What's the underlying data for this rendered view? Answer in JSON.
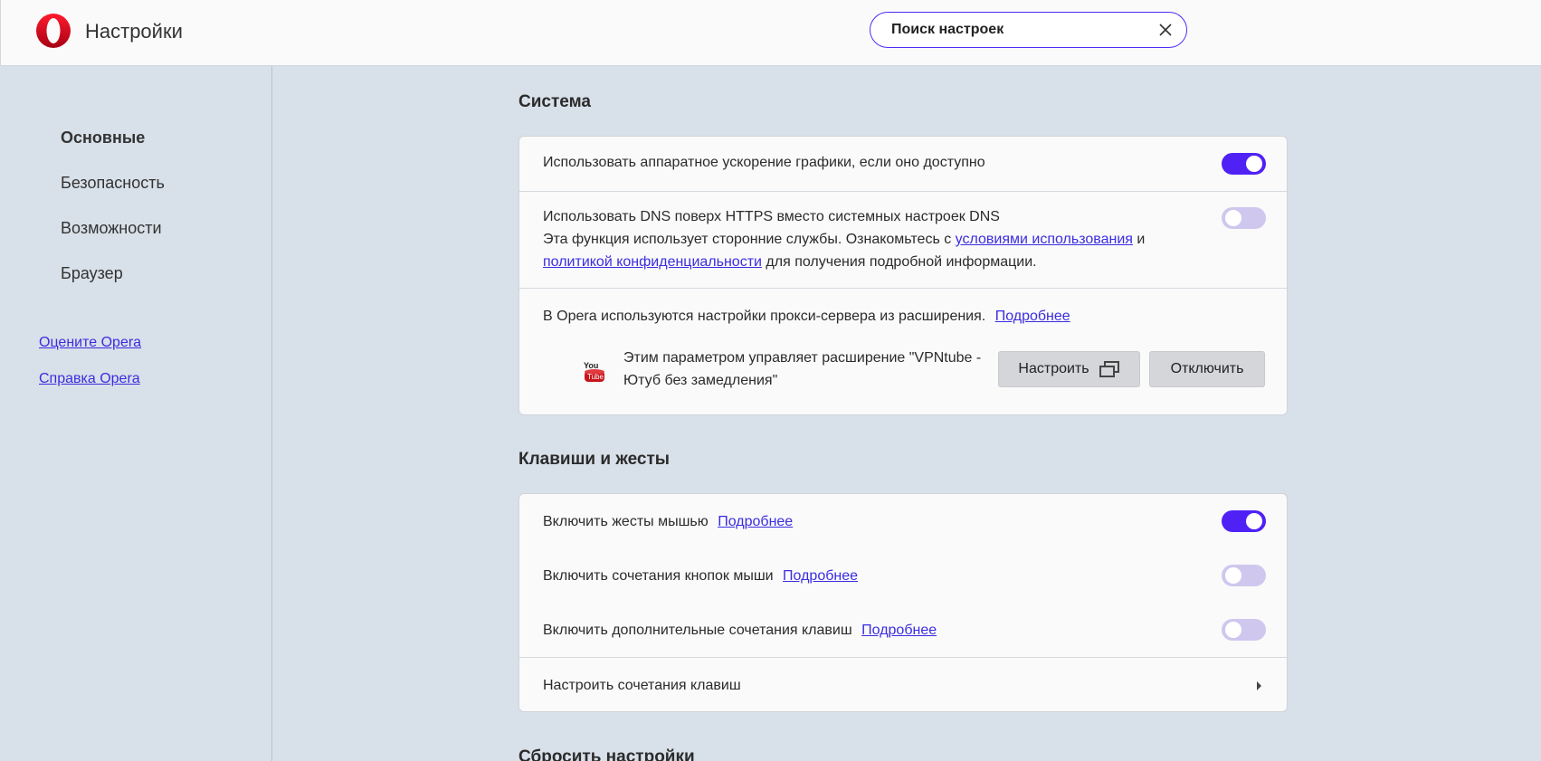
{
  "header": {
    "app_title": "Настройки",
    "search_value": "Поиск настроек"
  },
  "sidebar": {
    "items": [
      {
        "label": "Основные",
        "active": true
      },
      {
        "label": "Безопасность",
        "active": false
      },
      {
        "label": "Возможности",
        "active": false
      },
      {
        "label": "Браузер",
        "active": false
      }
    ],
    "links": [
      {
        "label": "Оцените Opera"
      },
      {
        "label": "Справка Opera"
      }
    ]
  },
  "system": {
    "title": "Система",
    "hw_accel": {
      "label": "Использовать аппаратное ускорение графики, если оно доступно",
      "enabled": true
    },
    "dns": {
      "label": "Использовать DNS поверх HTTPS вместо системных настроек DNS",
      "desc_part1": "Эта функция использует сторонние службы. Ознакомьтесь с",
      "terms_link": "условиями использования",
      "desc_and": "и",
      "privacy_link": "политикой конфиденциальности",
      "desc_part2": "для получения подробной информации.",
      "enabled": false
    },
    "proxy": {
      "label": "В Opera используются настройки прокси-сервера из расширения.",
      "more_link": "Подробнее",
      "ext_line1": "Этим параметром управляет расширение \"VPNtube -",
      "ext_line2": "Ютуб без замедления\"",
      "configure_button": "Настроить",
      "disable_button": "Отключить",
      "ext_icon": "youtube-tube-icon"
    }
  },
  "shortcuts": {
    "title": "Клавиши и жесты",
    "mouse_gestures": {
      "label": "Включить жесты мышью",
      "more_link": "Подробнее",
      "enabled": true
    },
    "rocker_gestures": {
      "label": "Включить сочетания кнопок мыши",
      "more_link": "Подробнее",
      "enabled": false
    },
    "advanced_keys": {
      "label": "Включить дополнительные сочетания клавиш",
      "more_link": "Подробнее",
      "enabled": false
    },
    "configure_keys": {
      "label": "Настроить сочетания клавиш"
    }
  },
  "reset": {
    "title": "Сбросить настройки"
  },
  "colors": {
    "accent": "#5021f5",
    "toggle_off": "#cfc7ee",
    "link": "#3b2de0",
    "logo_red": "#d6001c"
  }
}
